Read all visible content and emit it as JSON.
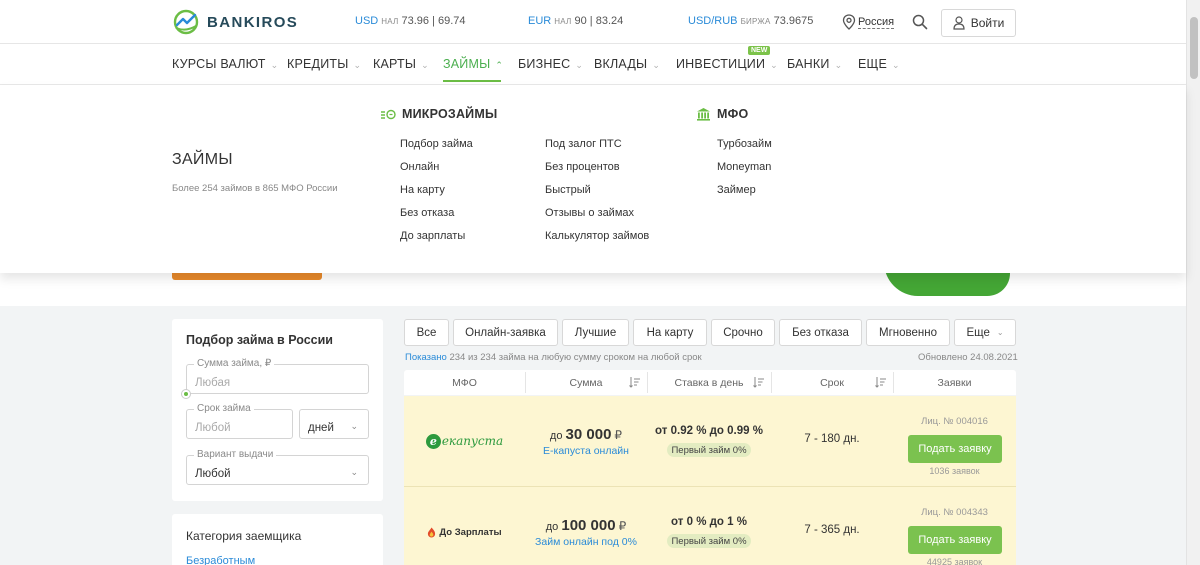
{
  "header": {
    "logo_text": "BANKIROS",
    "rates": [
      {
        "currency": "USD",
        "type": "нал",
        "value": "73.96 | 69.74"
      },
      {
        "currency": "EUR",
        "type": "нал",
        "value": "90 | 83.24"
      },
      {
        "currency": "USD/RUB",
        "type": "биржа",
        "value": "73.9675"
      }
    ],
    "region": "Россия",
    "login_label": "Войти"
  },
  "nav": {
    "items": [
      {
        "label": "КУРСЫ ВАЛЮТ"
      },
      {
        "label": "КРЕДИТЫ"
      },
      {
        "label": "КАРТЫ"
      },
      {
        "label": "ЗАЙМЫ"
      },
      {
        "label": "БИЗНЕС"
      },
      {
        "label": "ВКЛАДЫ"
      },
      {
        "label": "ИНВЕСТИЦИИ"
      },
      {
        "label": "БАНКИ"
      },
      {
        "label": "ЕЩЕ"
      }
    ],
    "active": "ЗАЙМЫ",
    "new_badge": "NEW"
  },
  "mega_menu": {
    "title": "ЗАЙМЫ",
    "subtitle": "Более 254 займов в 865 МФО России",
    "microloans": {
      "heading": "МИКРОЗАЙМЫ",
      "col1": [
        "Подбор займа",
        "Онлайн",
        "На карту",
        "Без отказа",
        "До зарплаты"
      ],
      "col2": [
        "Под залог ПТС",
        "Без процентов",
        "Быстрый",
        "Отзывы о займах",
        "Калькулятор займов"
      ]
    },
    "mfo": {
      "heading": "МФО",
      "links": [
        "Турбозайм",
        "Moneyman",
        "Займер"
      ]
    }
  },
  "filter": {
    "title": "Подбор займа в России",
    "amount": {
      "label": "Сумма займа, ₽",
      "placeholder": "Любая"
    },
    "term": {
      "label": "Срок займа",
      "placeholder": "Любой",
      "unit": "дней"
    },
    "payout": {
      "label": "Вариант выдачи",
      "value": "Любой"
    },
    "slider_position": 0
  },
  "category": {
    "title": "Категория заемщика",
    "first_link": "Безработным"
  },
  "tabs": [
    "Все",
    "Онлайн-заявка",
    "Лучшие",
    "На карту",
    "Срочно",
    "Без отказа",
    "Мгновенно",
    "Еще"
  ],
  "results": {
    "shown_label": "Показано",
    "shown_text": "234 из 234 займа на любую сумму сроком на любой срок",
    "updated": "Обновлено 24.08.2021"
  },
  "table": {
    "columns": [
      "МФО",
      "Сумма",
      "Ставка в день",
      "Срок",
      "Заявки"
    ],
    "rows": [
      {
        "brand": "екапуста",
        "brand_letter": "e",
        "amount_prefix": "до",
        "amount": "30 000",
        "currency": "₽",
        "product": "Е-капуста онлайн",
        "rate": "от 0.92 % до 0.99 %",
        "badge": "Первый займ 0%",
        "term": "7 - 180 дн.",
        "license": "Лиц. № 004016",
        "apply": "Подать заявку",
        "requests": "1036 заявок"
      },
      {
        "brand": "До Зарплаты",
        "brand_letter": "",
        "amount_prefix": "до",
        "amount": "100 000",
        "currency": "₽",
        "product": "Займ онлайн под 0%",
        "rate": "от 0 % до 1 %",
        "badge": "Первый займ 0%",
        "term": "7 - 365 дн.",
        "license": "Лиц. № 004343",
        "apply": "Подать заявку",
        "requests": "44925 заявок"
      }
    ]
  },
  "colors": {
    "brand_green": "#6bbd45",
    "link_blue": "#2a8bd8",
    "highlight_row": "#fdf6d2",
    "apply_button": "#7bc24f"
  }
}
